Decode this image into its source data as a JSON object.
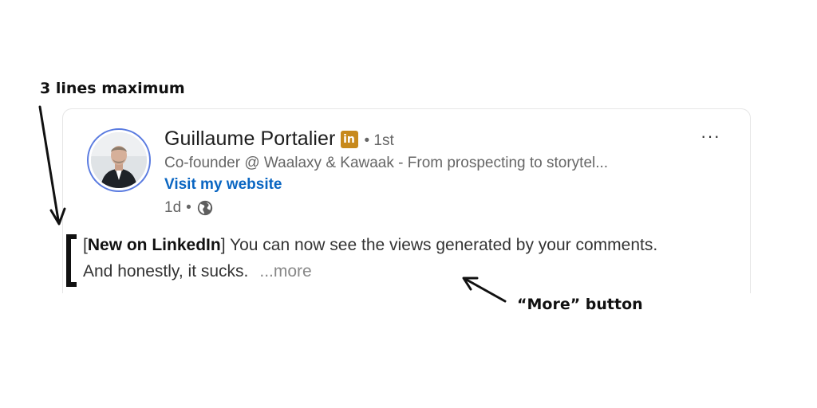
{
  "annotations": {
    "top_label": "3 lines maximum",
    "more_label": "“More” button"
  },
  "post": {
    "author_name": "Guillaume Portalier",
    "badge_text": "in",
    "connection_degree": "• 1st",
    "headline": "Co-founder @ Waalaxy & Kawaak - From prospecting to storytel...",
    "website_link": "Visit my website",
    "time_ago": "1d",
    "meta_separator": "•",
    "bracket_open": "[",
    "bold_tag": "New on LinkedIn",
    "bracket_close": "]",
    "body_text": " You can now see the views generated by your comments. And honestly, it sucks.",
    "more_label": "...more",
    "menu_label": "···"
  },
  "colors": {
    "badge": "#c7891c",
    "link": "#0a66c2",
    "avatar_ring": "#5a7be0"
  },
  "icons": {
    "globe": "globe-icon",
    "menu": "more-options-icon"
  }
}
